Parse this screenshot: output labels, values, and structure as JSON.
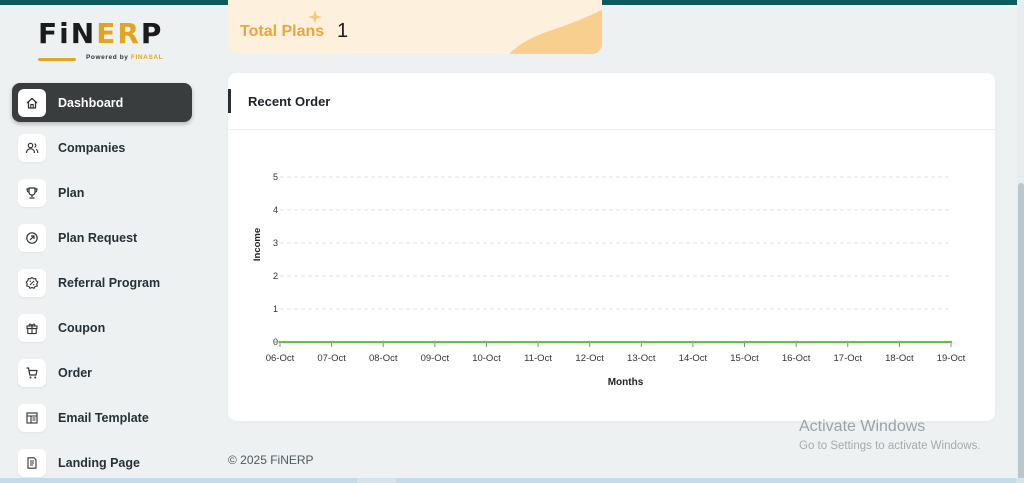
{
  "app": {
    "logo_main": "FiNERP",
    "logo_powered": "Powered by",
    "logo_brand": "FINASAL"
  },
  "colors": {
    "primary_dark": "#3a3d3e",
    "topbar": "#0e5b5d",
    "accent": "#e2a521",
    "plans_card_bg": "#fdf0dc",
    "chart_line": "#5cc442"
  },
  "sidebar": {
    "items": [
      {
        "label": "Dashboard",
        "icon": "home-icon",
        "active": true
      },
      {
        "label": "Companies",
        "icon": "users-icon",
        "active": false
      },
      {
        "label": "Plan",
        "icon": "trophy-icon",
        "active": false
      },
      {
        "label": "Plan Request",
        "icon": "arrow-circle-icon",
        "active": false
      },
      {
        "label": "Referral Program",
        "icon": "badge-percent-icon",
        "active": false
      },
      {
        "label": "Coupon",
        "icon": "gift-icon",
        "active": false
      },
      {
        "label": "Order",
        "icon": "cart-icon",
        "active": false
      },
      {
        "label": "Email Template",
        "icon": "template-icon",
        "active": false
      },
      {
        "label": "Landing Page",
        "icon": "page-icon",
        "active": false
      }
    ]
  },
  "stats": {
    "plans_label": "Total Plans",
    "plans_value": "1"
  },
  "recent_order": {
    "title": "Recent Order"
  },
  "chart_data": {
    "type": "line",
    "title": "",
    "xlabel": "Months",
    "ylabel": "Income",
    "categories": [
      "06-Oct",
      "07-Oct",
      "08-Oct",
      "09-Oct",
      "10-Oct",
      "11-Oct",
      "12-Oct",
      "13-Oct",
      "14-Oct",
      "15-Oct",
      "16-Oct",
      "17-Oct",
      "18-Oct",
      "19-Oct"
    ],
    "y_ticks": [
      0,
      1,
      2,
      3,
      4,
      5
    ],
    "ylim": [
      0,
      5
    ],
    "grid": true,
    "series": [
      {
        "values": [
          0,
          0,
          0,
          0,
          0,
          0,
          0,
          0,
          0,
          0,
          0,
          0,
          0,
          0
        ],
        "color": "#5cc442"
      }
    ]
  },
  "footer": {
    "copyright": "© 2025 FiNERP"
  },
  "watermark": {
    "title": "Activate Windows",
    "subtitle": "Go to Settings to activate Windows."
  }
}
